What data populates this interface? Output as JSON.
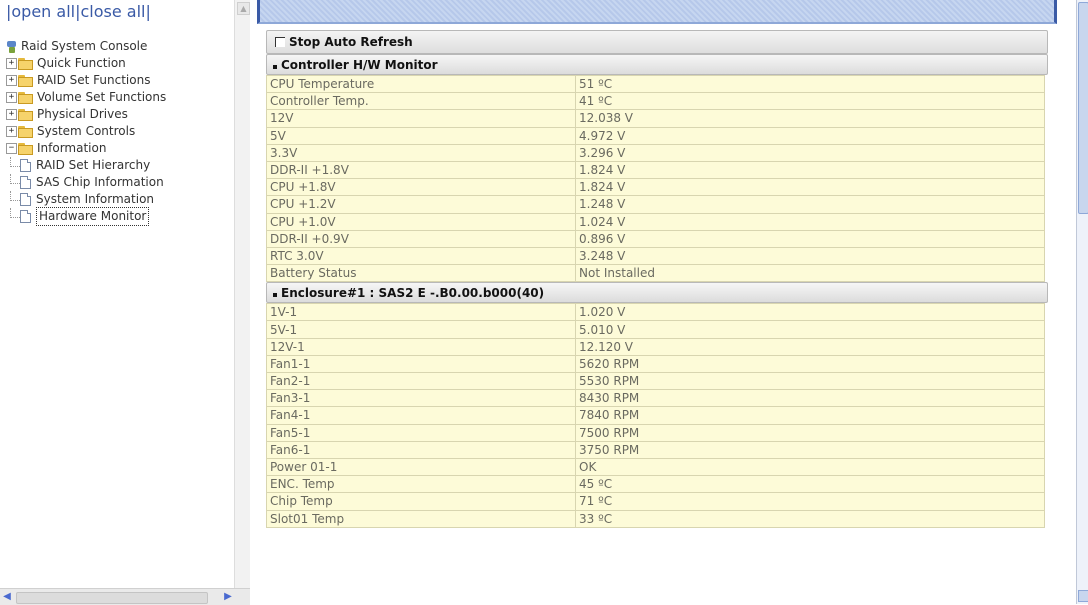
{
  "topbar": {
    "open_all": "open all",
    "close_all": "close all"
  },
  "tree": {
    "root": "Raid System Console",
    "folders": [
      "Quick Function",
      "RAID Set Functions",
      "Volume Set Functions",
      "Physical Drives",
      "System Controls"
    ],
    "expanded_folder": "Information",
    "children": [
      "RAID Set Hierarchy",
      "SAS Chip Information",
      "System Information",
      "Hardware Monitor"
    ],
    "selected": "Hardware Monitor"
  },
  "controls": {
    "stop_auto_refresh": "Stop Auto Refresh"
  },
  "controller": {
    "title": "Controller H/W Monitor",
    "rows": [
      [
        "CPU Temperature",
        "51 ºC"
      ],
      [
        "Controller Temp.",
        "41 ºC"
      ],
      [
        "12V",
        "12.038 V"
      ],
      [
        "5V",
        "4.972 V"
      ],
      [
        "3.3V",
        "3.296 V"
      ],
      [
        "DDR-II +1.8V",
        "1.824 V"
      ],
      [
        "CPU +1.8V",
        "1.824 V"
      ],
      [
        "CPU +1.2V",
        "1.248 V"
      ],
      [
        "CPU +1.0V",
        "1.024 V"
      ],
      [
        "DDR-II +0.9V",
        "0.896 V"
      ],
      [
        "RTC 3.0V",
        "3.248 V"
      ],
      [
        "Battery Status",
        "Not Installed"
      ]
    ]
  },
  "enclosure": {
    "title": "Enclosure#1 : SAS2 E -.B0.00.b000(40)",
    "rows": [
      [
        "1V-1",
        "1.020 V"
      ],
      [
        "5V-1",
        "5.010 V"
      ],
      [
        "12V-1",
        "12.120 V"
      ],
      [
        "Fan1-1",
        "5620 RPM"
      ],
      [
        "Fan2-1",
        "5530 RPM"
      ],
      [
        "Fan3-1",
        "8430 RPM"
      ],
      [
        "Fan4-1",
        "7840 RPM"
      ],
      [
        "Fan5-1",
        "7500 RPM"
      ],
      [
        "Fan6-1",
        "3750 RPM"
      ],
      [
        "Power 01-1",
        "OK"
      ],
      [
        "ENC. Temp",
        "45 ºC"
      ],
      [
        "Chip Temp",
        "71 ºC"
      ],
      [
        "Slot01 Temp",
        "33 ºC"
      ]
    ]
  }
}
